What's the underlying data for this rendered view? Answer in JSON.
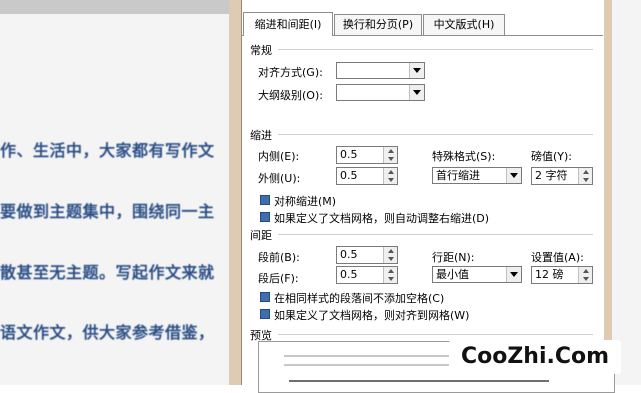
{
  "doc": {
    "lines": [
      "作、生活中，大家都有写作文",
      "要做到主题集中，围绕同一主",
      "散甚至无主题。写起作文来就",
      "语文作文，供大家参考借鉴，"
    ]
  },
  "tabs": [
    {
      "label": "缩进和间距(I)",
      "active": true
    },
    {
      "label": "换行和分页(P)",
      "active": false
    },
    {
      "label": "中文版式(H)",
      "active": false
    }
  ],
  "general": {
    "title": "常规",
    "alignment_label": "对齐方式(G):",
    "alignment_value": "",
    "outline_label": "大纲级别(O):",
    "outline_value": ""
  },
  "indent": {
    "title": "缩进",
    "inside_label": "内侧(E):",
    "inside_value": "0.5",
    "outside_label": "外侧(U):",
    "outside_value": "0.5",
    "special_label": "特殊格式(S):",
    "special_value": "首行缩进",
    "measure_label": "磅值(Y):",
    "measure_value": "2 字符",
    "mirror_label": "对称缩进(M)",
    "mirror_checked": true,
    "auto_label": "如果定义了文档网格，则自动调整右缩进(D)",
    "auto_checked": true
  },
  "spacing": {
    "title": "间距",
    "before_label": "段前(B):",
    "before_value": "0.5",
    "after_label": "段后(F):",
    "after_value": "0.5",
    "line_label": "行距(N):",
    "line_value": "最小值",
    "at_label": "设置值(A):",
    "at_value": "12 磅",
    "no_space_label": "在相同样式的段落间不添加空格(C)",
    "no_space_checked": true,
    "snap_label": "如果定义了文档网格，则对齐到网格(W)",
    "snap_checked": true
  },
  "preview": {
    "title": "预览"
  },
  "watermark": "CooZhi.Com"
}
